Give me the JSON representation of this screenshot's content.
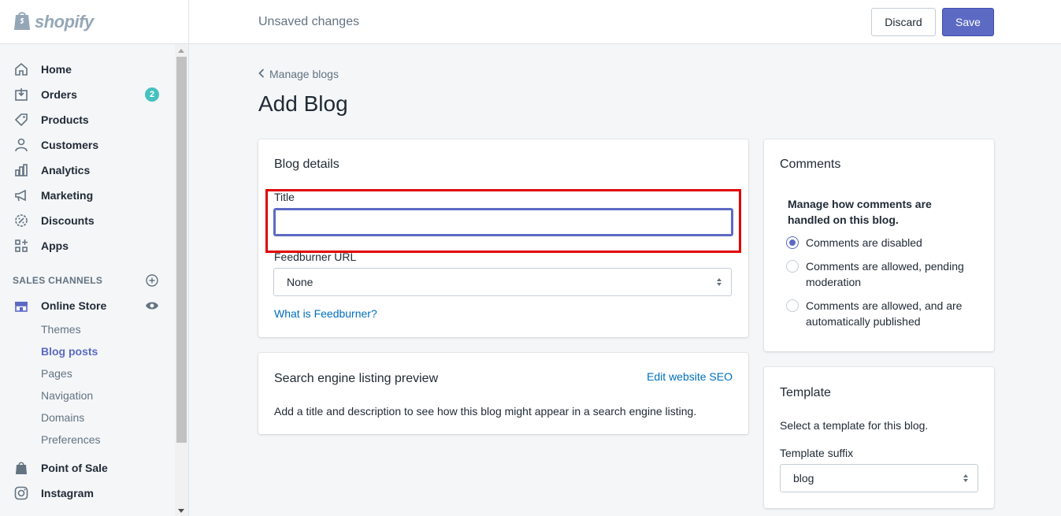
{
  "brand": {
    "name": "shopify"
  },
  "topbar": {
    "status": "Unsaved changes",
    "discard_label": "Discard",
    "save_label": "Save"
  },
  "sidebar": {
    "items": [
      {
        "label": "Home",
        "icon": "home-icon"
      },
      {
        "label": "Orders",
        "icon": "orders-icon",
        "badge": "2"
      },
      {
        "label": "Products",
        "icon": "tag-icon"
      },
      {
        "label": "Customers",
        "icon": "customer-icon"
      },
      {
        "label": "Analytics",
        "icon": "analytics-icon"
      },
      {
        "label": "Marketing",
        "icon": "megaphone-icon"
      },
      {
        "label": "Discounts",
        "icon": "discount-icon"
      },
      {
        "label": "Apps",
        "icon": "apps-icon"
      }
    ],
    "sales_channels_heading": "SALES CHANNELS",
    "online_store": {
      "label": "Online Store"
    },
    "online_store_subitems": [
      "Themes",
      "Blog posts",
      "Pages",
      "Navigation",
      "Domains",
      "Preferences"
    ],
    "pos": {
      "label": "Point of Sale"
    },
    "instagram": {
      "label": "Instagram"
    }
  },
  "main": {
    "breadcrumb": "Manage blogs",
    "page_title": "Add Blog",
    "blog_details": {
      "title": "Blog details",
      "title_field_label": "Title",
      "title_field_value": "",
      "feedburner_label": "Feedburner URL",
      "feedburner_value": "None",
      "feedburner_help": "What is Feedburner?"
    },
    "seo": {
      "title": "Search engine listing preview",
      "edit_link": "Edit website SEO",
      "description": "Add a title and description to see how this blog might appear in a search engine listing."
    },
    "comments": {
      "title": "Comments",
      "heading": "Manage how comments are handled on this blog.",
      "options": [
        {
          "label": "Comments are disabled",
          "checked": true
        },
        {
          "label": "Comments are allowed, pending moderation",
          "checked": false
        },
        {
          "label": "Comments are allowed, and are automatically published",
          "checked": false
        }
      ]
    },
    "template": {
      "title": "Template",
      "description": "Select a template for this blog.",
      "suffix_label": "Template suffix",
      "suffix_value": "blog"
    }
  },
  "colors": {
    "accent": "#5c6ac4",
    "highlight": "#e00000",
    "badge": "#47c1bf",
    "link": "#006fbb"
  }
}
